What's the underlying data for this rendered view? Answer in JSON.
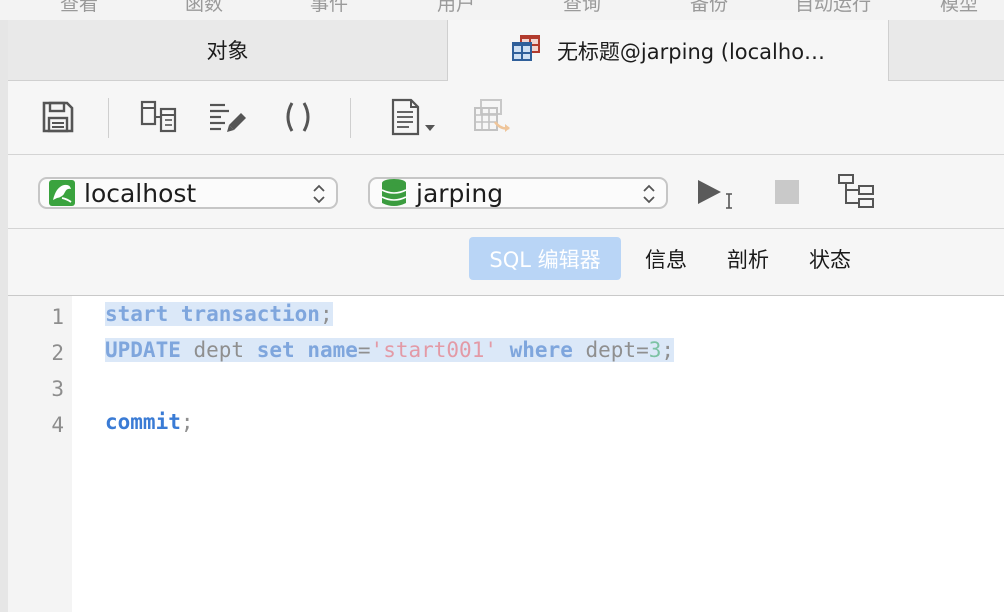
{
  "menubar": {
    "items": [
      "查看",
      "函数",
      "事件",
      "用户",
      "查询",
      "备份",
      "自动运行",
      "模型"
    ]
  },
  "tabs": [
    {
      "label": "对象",
      "active": false
    },
    {
      "label": "无标题@jarping (localho…",
      "active": true,
      "icon": "table-icon"
    }
  ],
  "toolbar": {
    "buttons": [
      {
        "name": "save-icon"
      },
      {
        "name": "query-builder-icon"
      },
      {
        "name": "beautify-sql-icon"
      },
      {
        "name": "code-snippet-icon"
      },
      {
        "name": "text-file-icon"
      },
      {
        "name": "export-result-icon",
        "disabled": true
      }
    ]
  },
  "connection": {
    "server": "localhost",
    "database": "jarping",
    "server_icon": "mysql-server-icon",
    "database_icon": "database-icon"
  },
  "actions": {
    "run": "run-icon",
    "stop": "stop-icon",
    "explain": "explain-icon"
  },
  "subtabs": [
    {
      "label": "SQL 编辑器",
      "active": true
    },
    {
      "label": "信息",
      "active": false
    },
    {
      "label": "剖析",
      "active": false
    },
    {
      "label": "状态",
      "active": false
    }
  ],
  "editor": {
    "line_numbers": [
      "1",
      "2",
      "3",
      "4"
    ],
    "lines": [
      [
        {
          "t": "start transaction",
          "c": "kw"
        },
        {
          "t": ";",
          "c": "pn"
        }
      ],
      [
        {
          "t": "UPDATE",
          "c": "kw"
        },
        {
          "t": " dept ",
          "c": "id"
        },
        {
          "t": "set",
          "c": "kw"
        },
        {
          "t": " ",
          "c": "id"
        },
        {
          "t": "name",
          "c": "kw"
        },
        {
          "t": "=",
          "c": "pn"
        },
        {
          "t": "'start001'",
          "c": "str"
        },
        {
          "t": " ",
          "c": "id"
        },
        {
          "t": "where",
          "c": "kw"
        },
        {
          "t": " dept=",
          "c": "id"
        },
        {
          "t": "3",
          "c": "num"
        },
        {
          "t": ";",
          "c": "pn"
        }
      ],
      [],
      [
        {
          "t": "commit",
          "c": "kw2"
        },
        {
          "t": ";",
          "c": "pn"
        }
      ]
    ],
    "selected_lines": [
      1,
      2
    ]
  },
  "colors": {
    "active_subtab": "#b9d5f6",
    "keyword": "#3a7bd5",
    "string": "#e39aa6",
    "number": "#7cc2a4",
    "selection": "#dbe8f8"
  }
}
